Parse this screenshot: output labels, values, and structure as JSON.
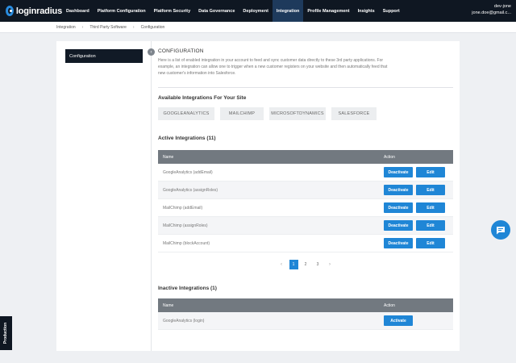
{
  "header": {
    "logo_text": "loginradius",
    "nav": [
      "Dashboard",
      "Platform Configuration",
      "Platform Security",
      "Data Governance",
      "Deployment",
      "Integration",
      "Profile Management",
      "Insights",
      "Support"
    ],
    "active_nav": "Integration",
    "user_name": "dev-jone",
    "user_email": "jone.doe@gmail.c..."
  },
  "breadcrumb": [
    "Integration",
    "Third Party Software",
    "Configuration"
  ],
  "sidebar": {
    "items": [
      {
        "label": "Configuration"
      }
    ]
  },
  "configuration": {
    "title": "CONFIGURATION",
    "description": "Here is a list of enabled integration in your account to feed and sync customer data directly to these 3rd party applications. For example, an integration can allow one to trigger when a new customer registers on your website and then automatically feed that new customer's information into Salesforce."
  },
  "available": {
    "title": "Available Integrations For Your Site",
    "items": [
      "GOOGLEANALYTICS",
      "MAILCHIMP",
      "MICROSOFTDYNAMICS",
      "SALESFORCE"
    ]
  },
  "active": {
    "title": "Active Integrations (11)",
    "columns": {
      "name": "Name",
      "action": "Action"
    },
    "rows": [
      {
        "name": "GoogleAnalytics (addEmail)"
      },
      {
        "name": "GoogleAnalytics (assignRoles)"
      },
      {
        "name": "MailChimp (addEmail)"
      },
      {
        "name": "MailChimp (assignRoles)"
      },
      {
        "name": "MailChimp (blockAccount)"
      }
    ],
    "deactivate_label": "Deactivate",
    "edit_label": "Edit"
  },
  "pagination": {
    "prev": "‹",
    "pages": [
      "1",
      "2",
      "3"
    ],
    "current": "1",
    "next": "›"
  },
  "inactive": {
    "title": "Inactive Integrations (1)",
    "columns": {
      "name": "Name",
      "action": "Action"
    },
    "rows": [
      {
        "name": "GoogleAnalytics (login)"
      }
    ],
    "activate_label": "Activate"
  },
  "environment_tab": "Production",
  "icons": {
    "collapse": "chevron-left-icon",
    "chat": "chat-icon",
    "logo": "loginradius-logo-icon"
  },
  "colors": {
    "topbar": "#0f1722",
    "active_nav": "#1e3a5c",
    "accent": "#1f86d6",
    "table_header": "#727980"
  }
}
